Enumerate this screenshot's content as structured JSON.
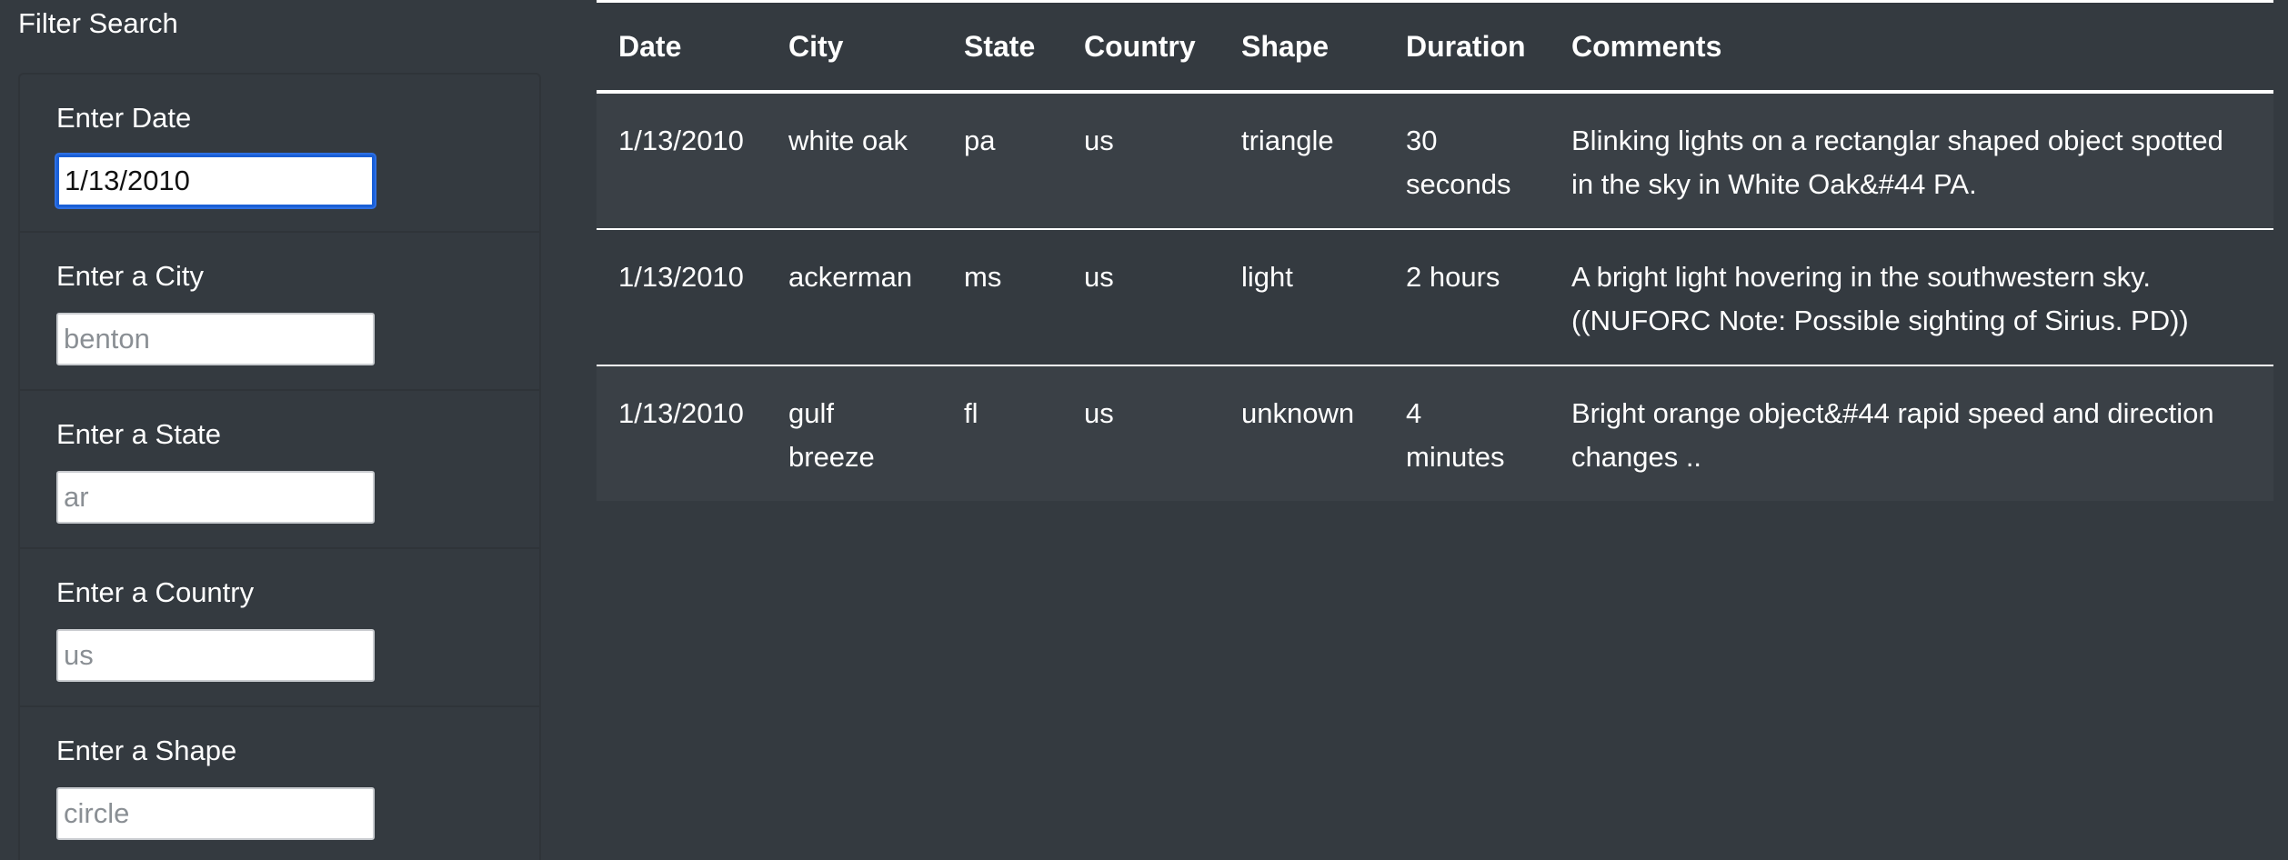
{
  "sidebar": {
    "title": "Filter Search",
    "filters": [
      {
        "label": "Enter Date",
        "value": "1/13/2010",
        "placeholder": ""
      },
      {
        "label": "Enter a City",
        "value": "",
        "placeholder": "benton"
      },
      {
        "label": "Enter a State",
        "value": "",
        "placeholder": "ar"
      },
      {
        "label": "Enter a Country",
        "value": "",
        "placeholder": "us"
      },
      {
        "label": "Enter a Shape",
        "value": "",
        "placeholder": "circle"
      }
    ]
  },
  "table": {
    "headers": [
      "Date",
      "City",
      "State",
      "Country",
      "Shape",
      "Duration",
      "Comments"
    ],
    "rows": [
      {
        "date": "1/13/2010",
        "city": "white oak",
        "state": "pa",
        "country": "us",
        "shape": "triangle",
        "duration": "30 seconds",
        "comments": "Blinking lights on a rectanglar shaped object spotted in the sky in White Oak&#44 PA."
      },
      {
        "date": "1/13/2010",
        "city": "ackerman",
        "state": "ms",
        "country": "us",
        "shape": "light",
        "duration": "2 hours",
        "comments": "A bright light hovering in the southwestern sky. ((NUFORC Note: Possible sighting of Sirius. PD))"
      },
      {
        "date": "1/13/2010",
        "city": "gulf breeze",
        "state": "fl",
        "country": "us",
        "shape": "unknown",
        "duration": "4 minutes",
        "comments": "Bright orange object&#44 rapid speed and direction changes .."
      }
    ]
  }
}
